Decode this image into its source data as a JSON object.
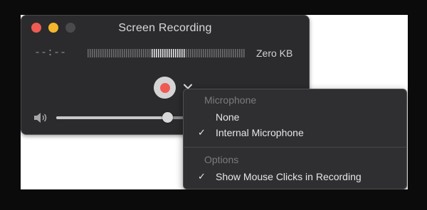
{
  "window": {
    "title": "Screen Recording",
    "elapsed": "--:--",
    "file_size": "Zero KB",
    "volume_fraction": 0.68
  },
  "menu": {
    "microphone_header": "Microphone",
    "mic_options": [
      {
        "label": "None",
        "checked": false
      },
      {
        "label": "Internal Microphone",
        "checked": true
      }
    ],
    "options_header": "Options",
    "show_clicks": {
      "label": "Show Mouse Clicks in Recording",
      "checked": true
    },
    "check_glyph": "✓"
  },
  "colors": {
    "record": "#ef5a55",
    "close": "#ee5b52",
    "minimize": "#f3b72c"
  }
}
